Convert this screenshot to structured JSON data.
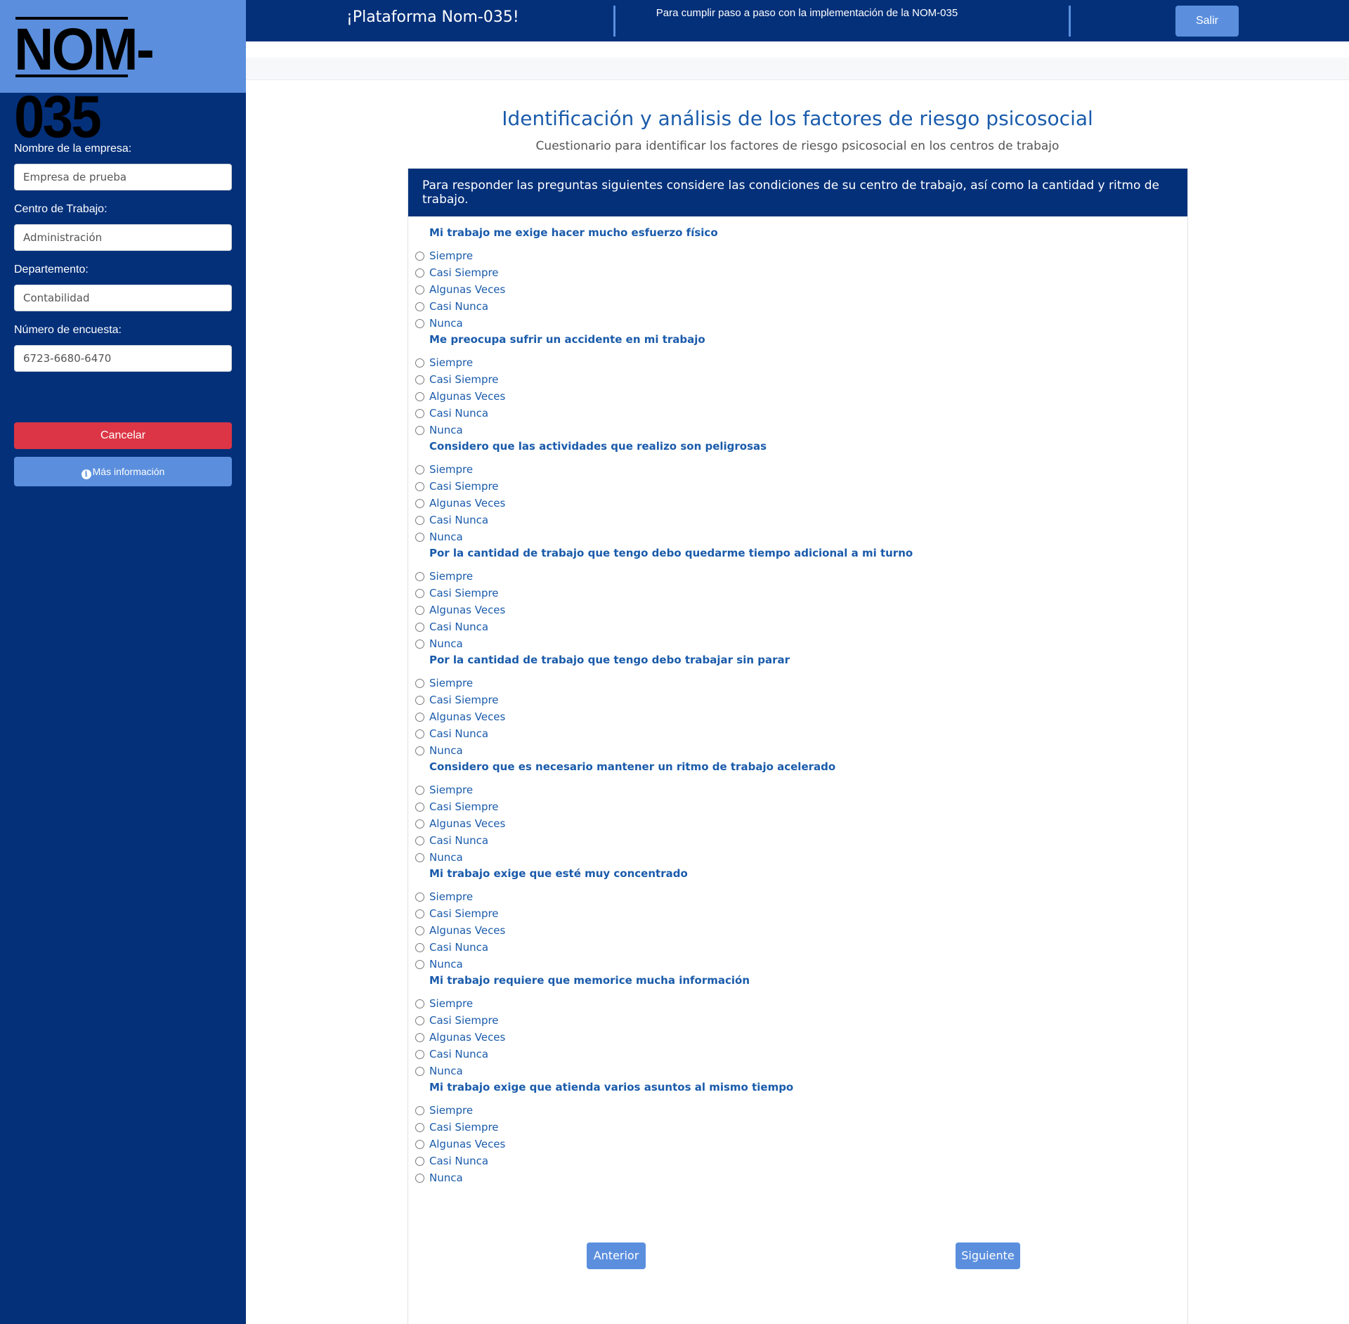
{
  "sidebar": {
    "logo_text": "NOM-035",
    "fields": [
      {
        "label": "Nombre de la empresa:",
        "value": "Empresa de prueba"
      },
      {
        "label": "Centro de Trabajo:",
        "value": "Administración"
      },
      {
        "label": "Departemento:",
        "value": "Contabilidad"
      },
      {
        "label": "Número de encuesta:",
        "value": "6723-6680-6470"
      }
    ],
    "cancel_label": "Cancelar",
    "info_label": "Más información",
    "info_icon": "info-circle-icon"
  },
  "header": {
    "title": "¡Plataforma Nom-035!",
    "tagline": "Para cumplir paso a paso con la implementación de la NOM-035",
    "logout_label": "Salir"
  },
  "main": {
    "title": "Identificación y análisis de los factores de riesgo psicosocial",
    "subtitle": "Cuestionario para identificar los factores de riesgo psicosocial en los centros de trabajo",
    "instructions": "Para responder las preguntas siguientes considere las condiciones de su centro de trabajo, así como la cantidad y ritmo de trabajo.",
    "options": [
      "Siempre",
      "Casi Siempre",
      "Algunas Veces",
      "Casi Nunca",
      "Nunca"
    ],
    "questions": [
      "Mi trabajo me exige hacer mucho esfuerzo físico",
      "Me preocupa sufrir un accidente en mi trabajo",
      "Considero que las actividades que realizo son peligrosas",
      "Por la cantidad de trabajo que tengo debo quedarme tiempo adicional a mi turno",
      "Por la cantidad de trabajo que tengo debo trabajar sin parar",
      "Considero que es necesario mantener un ritmo de trabajo acelerado",
      "Mi trabajo exige que esté muy concentrado",
      "Mi trabajo requiere que memorice mucha información",
      "Mi trabajo exige que atienda varios asuntos al mismo tiempo"
    ],
    "prev_label": "Anterior",
    "next_label": "Siguiente"
  },
  "colors": {
    "navy": "#04307a",
    "accent_blue": "#5b8fde",
    "danger": "#dc3545",
    "question_text": "#1a5bab"
  }
}
